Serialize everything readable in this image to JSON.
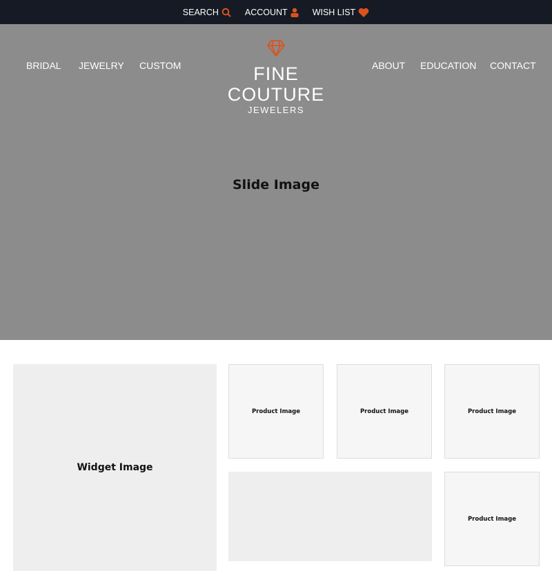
{
  "topbar": {
    "search": "SEARCH",
    "account": "ACCOUNT",
    "wishlist": "WISH LIST",
    "accent": "#d9531e"
  },
  "nav": {
    "left": [
      "BRIDAL",
      "JEWELRY",
      "CUSTOM"
    ],
    "right": [
      "ABOUT",
      "EDUCATION",
      "CONTACT"
    ]
  },
  "logo": {
    "line1": "FINE COUTURE",
    "line2": "JEWELERS"
  },
  "hero": {
    "label": "Slide Image"
  },
  "widget": {
    "label": "Widget Image"
  },
  "products": [
    "Product Image",
    "Product Image",
    "Product Image",
    "Product Image"
  ]
}
